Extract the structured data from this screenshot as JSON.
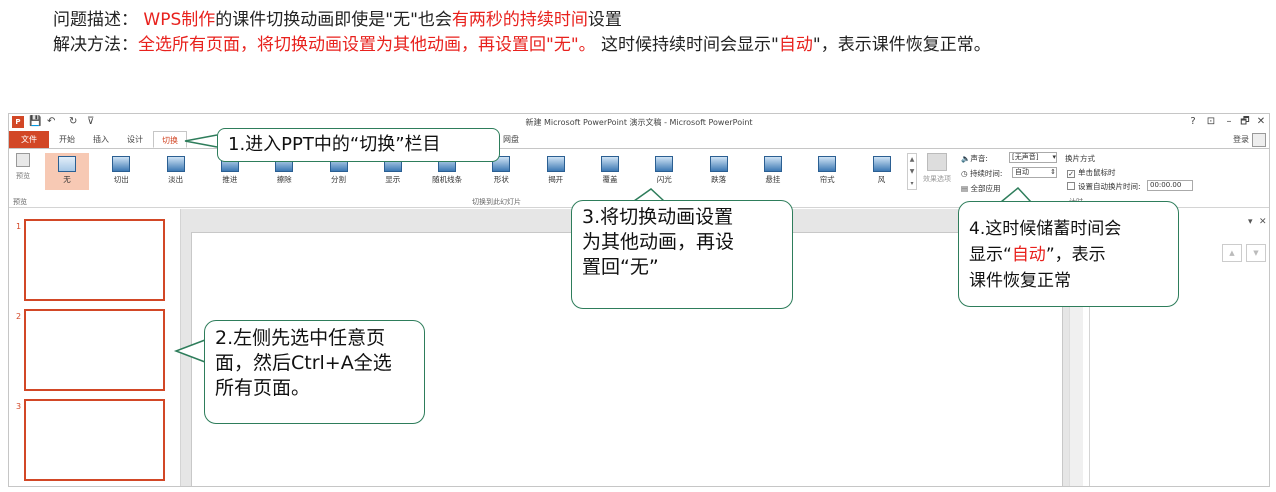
{
  "description": {
    "line1": {
      "label": "问题描述：",
      "part1": "WPS制作",
      "part2": "的课件切换动画即使是\"无\"也会",
      "part3": "有两秒的持续时间",
      "part4": "设置"
    },
    "line2": {
      "label": "解决方法：",
      "part1": "全选所有页面，将切换动画设置为其他动画，再设置回\"无\"。",
      "part2": " 这时候持续时间会显示\"",
      "part3": "自动",
      "part4": "\"，表示课件恢复正常。"
    }
  },
  "window": {
    "title": "新建 Microsoft PowerPoint 演示文稿 - Microsoft PowerPoint",
    "help": "?",
    "minimize": "–",
    "restore": "🗗",
    "close": "✕",
    "ribbon_display": "⊡",
    "login": "登录"
  },
  "quick_access": {
    "app_icon": "P",
    "save": "💾",
    "undo": "↶",
    "redo": "↻",
    "customize": "⊽"
  },
  "tabs": {
    "file": "文件",
    "home": "开始",
    "insert": "插入",
    "design": "设计",
    "transitions": "切换",
    "extra": "网盘"
  },
  "ribbon": {
    "preview_label": "预览",
    "preview_group": "预览",
    "gallery_group": "切换到此幻灯片",
    "effect_options": "效果选项",
    "transitions": [
      "无",
      "切出",
      "淡出",
      "推进",
      "擦除",
      "分割",
      "显示",
      "随机线条",
      "形状",
      "揭开",
      "覆盖",
      "闪光",
      "跌落",
      "悬挂",
      "帘式",
      "风"
    ],
    "selected_transition": "无",
    "scroll_up": "▲",
    "scroll_down": "▼",
    "scroll_more": "▾"
  },
  "timing": {
    "sound_label": "声音:",
    "sound_value": "[无声音]",
    "duration_label": "持续时间:",
    "duration_value": "自动",
    "apply_all": "全部应用",
    "advance_title": "换片方式",
    "on_click": "单击鼠标时",
    "on_click_checked": "✓",
    "after_label": "设置自动换片时间:",
    "after_value": "00:00.00",
    "group_label": "计时",
    "dropdown": "▾",
    "spinner": "⇕"
  },
  "thumbnails": [
    "1",
    "2",
    "3"
  ],
  "right_pane": {
    "menu": "▾",
    "close": "✕",
    "nav_up": "▲",
    "nav_down": "▼"
  },
  "callouts": {
    "c1": "1.进入PPT中的“切换”栏目",
    "c2": {
      "line1": "2.左侧先选中任意页",
      "line2": "面，然后Ctrl+A全选",
      "line3": "所有页面。"
    },
    "c3": {
      "line1": "3.将切换动画设置",
      "line2": "为其他动画，再设",
      "line3": "置回“无”"
    },
    "c4": {
      "line1": "4.这时候储蓄时间会",
      "line2a": "显示“",
      "line2b": "自动",
      "line2c": "”，表示",
      "line3": "课件恢复正常"
    }
  },
  "colors": {
    "accent_red": "#e8211d",
    "ppt_orange": "#d24726",
    "callout_border": "#2e7d5b",
    "selected_bg": "#f7c9b4"
  }
}
